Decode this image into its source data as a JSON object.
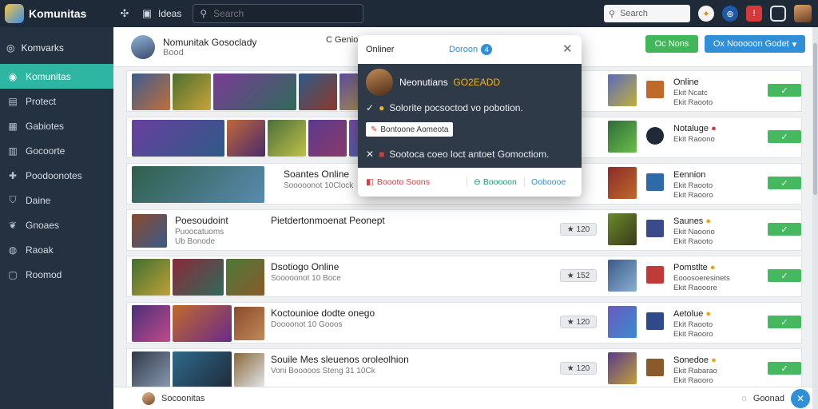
{
  "topbar": {
    "brand": "Komunitas",
    "link_label": "Ideas",
    "search_placeholder": "Search",
    "search2_placeholder": "Search"
  },
  "sidebar": {
    "top_label": "Komvarks",
    "items": [
      {
        "label": "Komunitas",
        "icon": "target-icon",
        "active": true
      },
      {
        "label": "Protect",
        "icon": "box-icon"
      },
      {
        "label": "Gabiotes",
        "icon": "grid-icon"
      },
      {
        "label": "Gocoorte",
        "icon": "tile-icon"
      },
      {
        "label": "Poodoonotes",
        "icon": "puzzle-icon"
      },
      {
        "label": "Daine",
        "icon": "shield-icon"
      },
      {
        "label": "Gnoaes",
        "icon": "leaf-icon"
      },
      {
        "label": "Raoak",
        "icon": "circle-icon"
      },
      {
        "label": "Roomod",
        "icon": "square-icon"
      }
    ]
  },
  "header": {
    "title": "Nomunitak Gosoclady",
    "subtitle": "Bood",
    "category": "C  Genioe",
    "green_button": "Oc Nons",
    "blue_button": "Ox Nooooon Godet"
  },
  "rows": [
    {
      "title": "",
      "subtitle": "",
      "count": "",
      "name": "Online",
      "meta1": "Ekit Ncatc",
      "meta2": "Ekit Raooto",
      "thumbs": [
        "#3b5c8f",
        "#4c6e2f",
        "#7a3b96",
        "#2f5a86",
        "#5a4a9e"
      ]
    },
    {
      "title": "",
      "subtitle": "",
      "count": "",
      "name": "Notaluge",
      "meta1": "Ekit Raoono",
      "meta2": "",
      "thumbs": [
        "#6a3fa0",
        "#c0683a",
        "#4a6f3a",
        "#5b3a8e",
        "#7c4aa8",
        "#8e5b30"
      ]
    },
    {
      "title": "Soantes Online",
      "subtitle": "Sooooonot 10Clock",
      "count": "",
      "name": "Eennion",
      "meta1": "Ekit Raooto",
      "meta2": "Ekit Raooro",
      "thumbs": [
        "#2f5f4a"
      ]
    },
    {
      "title": "Poesoudoint",
      "subtitle": "Puoocatuoms",
      "sub2": "Ub Bonode",
      "title2": "Pietdertonmoenat Peonept",
      "count": "120",
      "name": "Saunes",
      "meta1": "Ekit Naoono",
      "meta2": "Ekit Raooto",
      "thumbs": [
        "#8a4a2a"
      ]
    },
    {
      "title": "Dsotiogo Online",
      "subtitle": "Sooooonot 10 Boce",
      "count": "152",
      "name": "Pomstlte",
      "meta1": "Eooosoeresinets",
      "meta2": "Ekit Raooore",
      "thumbs": [
        "#3f6f2f",
        "#8a2a3a",
        "#4a7a3a"
      ]
    },
    {
      "title": "Koctounioe dodte onego",
      "subtitle": "Doooonot 10 Gooos",
      "count": "120",
      "name": "Aetolue",
      "meta1": "Ekit Raooto",
      "meta2": "Ekit Raooro",
      "thumbs": [
        "#4a2f7a",
        "#c06a2a",
        "#8a4a2a"
      ]
    },
    {
      "title": "Souile Mes sleuenos oroleolhion",
      "subtitle": "Voni Booooos Steng 31 10Ck",
      "count": "120",
      "name": "Sonedoe",
      "meta1": "Ekit Rabarao",
      "meta2": "Ekit Raooro",
      "thumbs": [
        "#2f3a4a",
        "#2f6a8a",
        "#8a6a3a"
      ]
    }
  ],
  "row_button": "✓",
  "footer": {
    "label": "Socoonitas",
    "right_label": "Goonad"
  },
  "popover": {
    "title": "Onliner",
    "link": "Doroon",
    "badge": "4",
    "user_name": "Neonutians",
    "user_highlight": "GO2EADD",
    "line1": "Solorite pocsoctod vo pobotion.",
    "tag": "Bontoone Aomeota",
    "line2": "Sootoca coeo loct antoet Gomoctiom.",
    "foot_a": "Boooto Soons",
    "foot_b": "Booooon",
    "foot_c": "Ooboooe"
  }
}
